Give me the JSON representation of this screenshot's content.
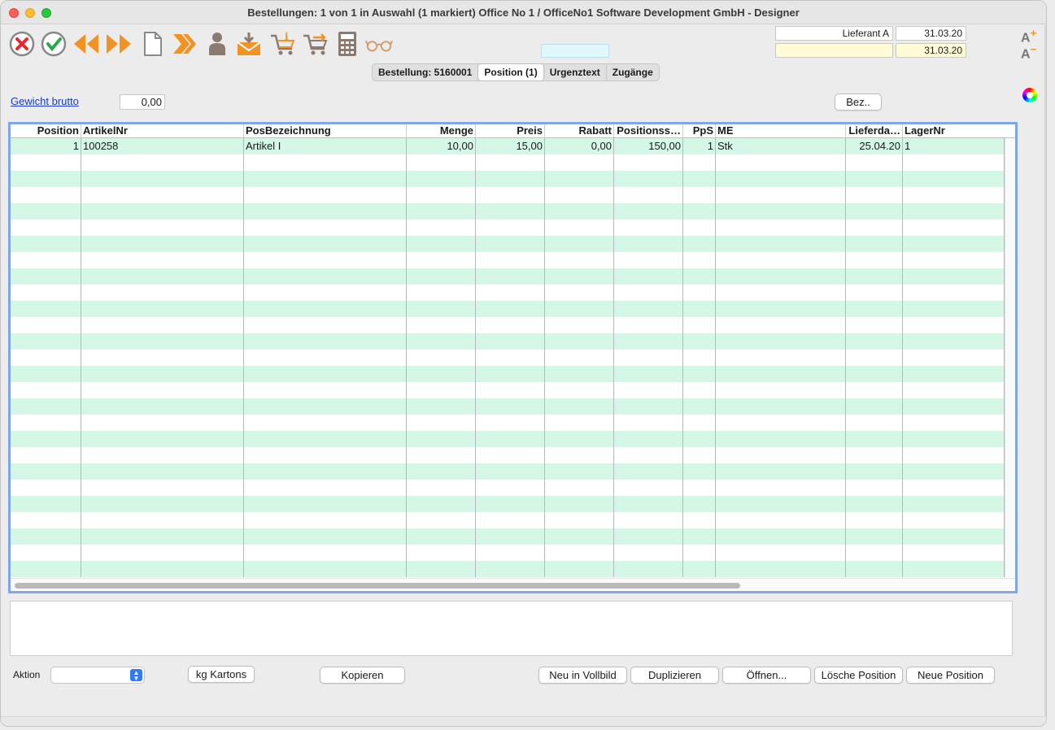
{
  "window": {
    "title": "Bestellungen: 1 von 1 in Auswahl  (1 markiert) Office No 1 /  OfficeNo1 Software Development GmbH - Designer"
  },
  "toolbar": {
    "icons": [
      "cancel-icon",
      "confirm-icon",
      "previous-icon",
      "next-icon",
      "new-document-icon",
      "forward-icon",
      "person-icon",
      "inbox-icon",
      "cart-info-icon",
      "cart-arrow-icon",
      "calculator-icon",
      "glasses-icon"
    ]
  },
  "header_fields": {
    "lieferant": "Lieferant A",
    "date1": "31.03.20",
    "field_blank": "",
    "date2": "31.03.20"
  },
  "tabs": [
    {
      "label": "Bestellung: 5160001",
      "active": false
    },
    {
      "label": "Position (1)",
      "active": true
    },
    {
      "label": "Urgenztext",
      "active": false
    },
    {
      "label": "Zugänge",
      "active": false
    }
  ],
  "weight": {
    "link_label": "Gewicht brutto",
    "value": "0,00"
  },
  "bez_button": "Bez..",
  "table": {
    "columns": [
      "Position",
      "ArtikelNr",
      "PosBezeichnung",
      "Menge",
      "Preis",
      "Rabatt",
      "Positionss…",
      "PpS",
      "ME",
      "Lieferda…",
      "LagerNr"
    ],
    "rows": [
      [
        "1",
        "100258",
        "Artikel I",
        "10,00",
        "15,00",
        "0,00",
        "150,00",
        "1",
        "Stk",
        "25.04.20",
        "1"
      ]
    ]
  },
  "bottom": {
    "aktion_label": "Aktion",
    "aktion_value": "",
    "kg_button": "kg Kartons",
    "kopieren": "Kopieren",
    "neu_vollbild": "Neu in Vollbild",
    "duplizieren": "Duplizieren",
    "oeffnen": "Öffnen...",
    "loesche": "Lösche Position",
    "neue": "Neue Position"
  }
}
